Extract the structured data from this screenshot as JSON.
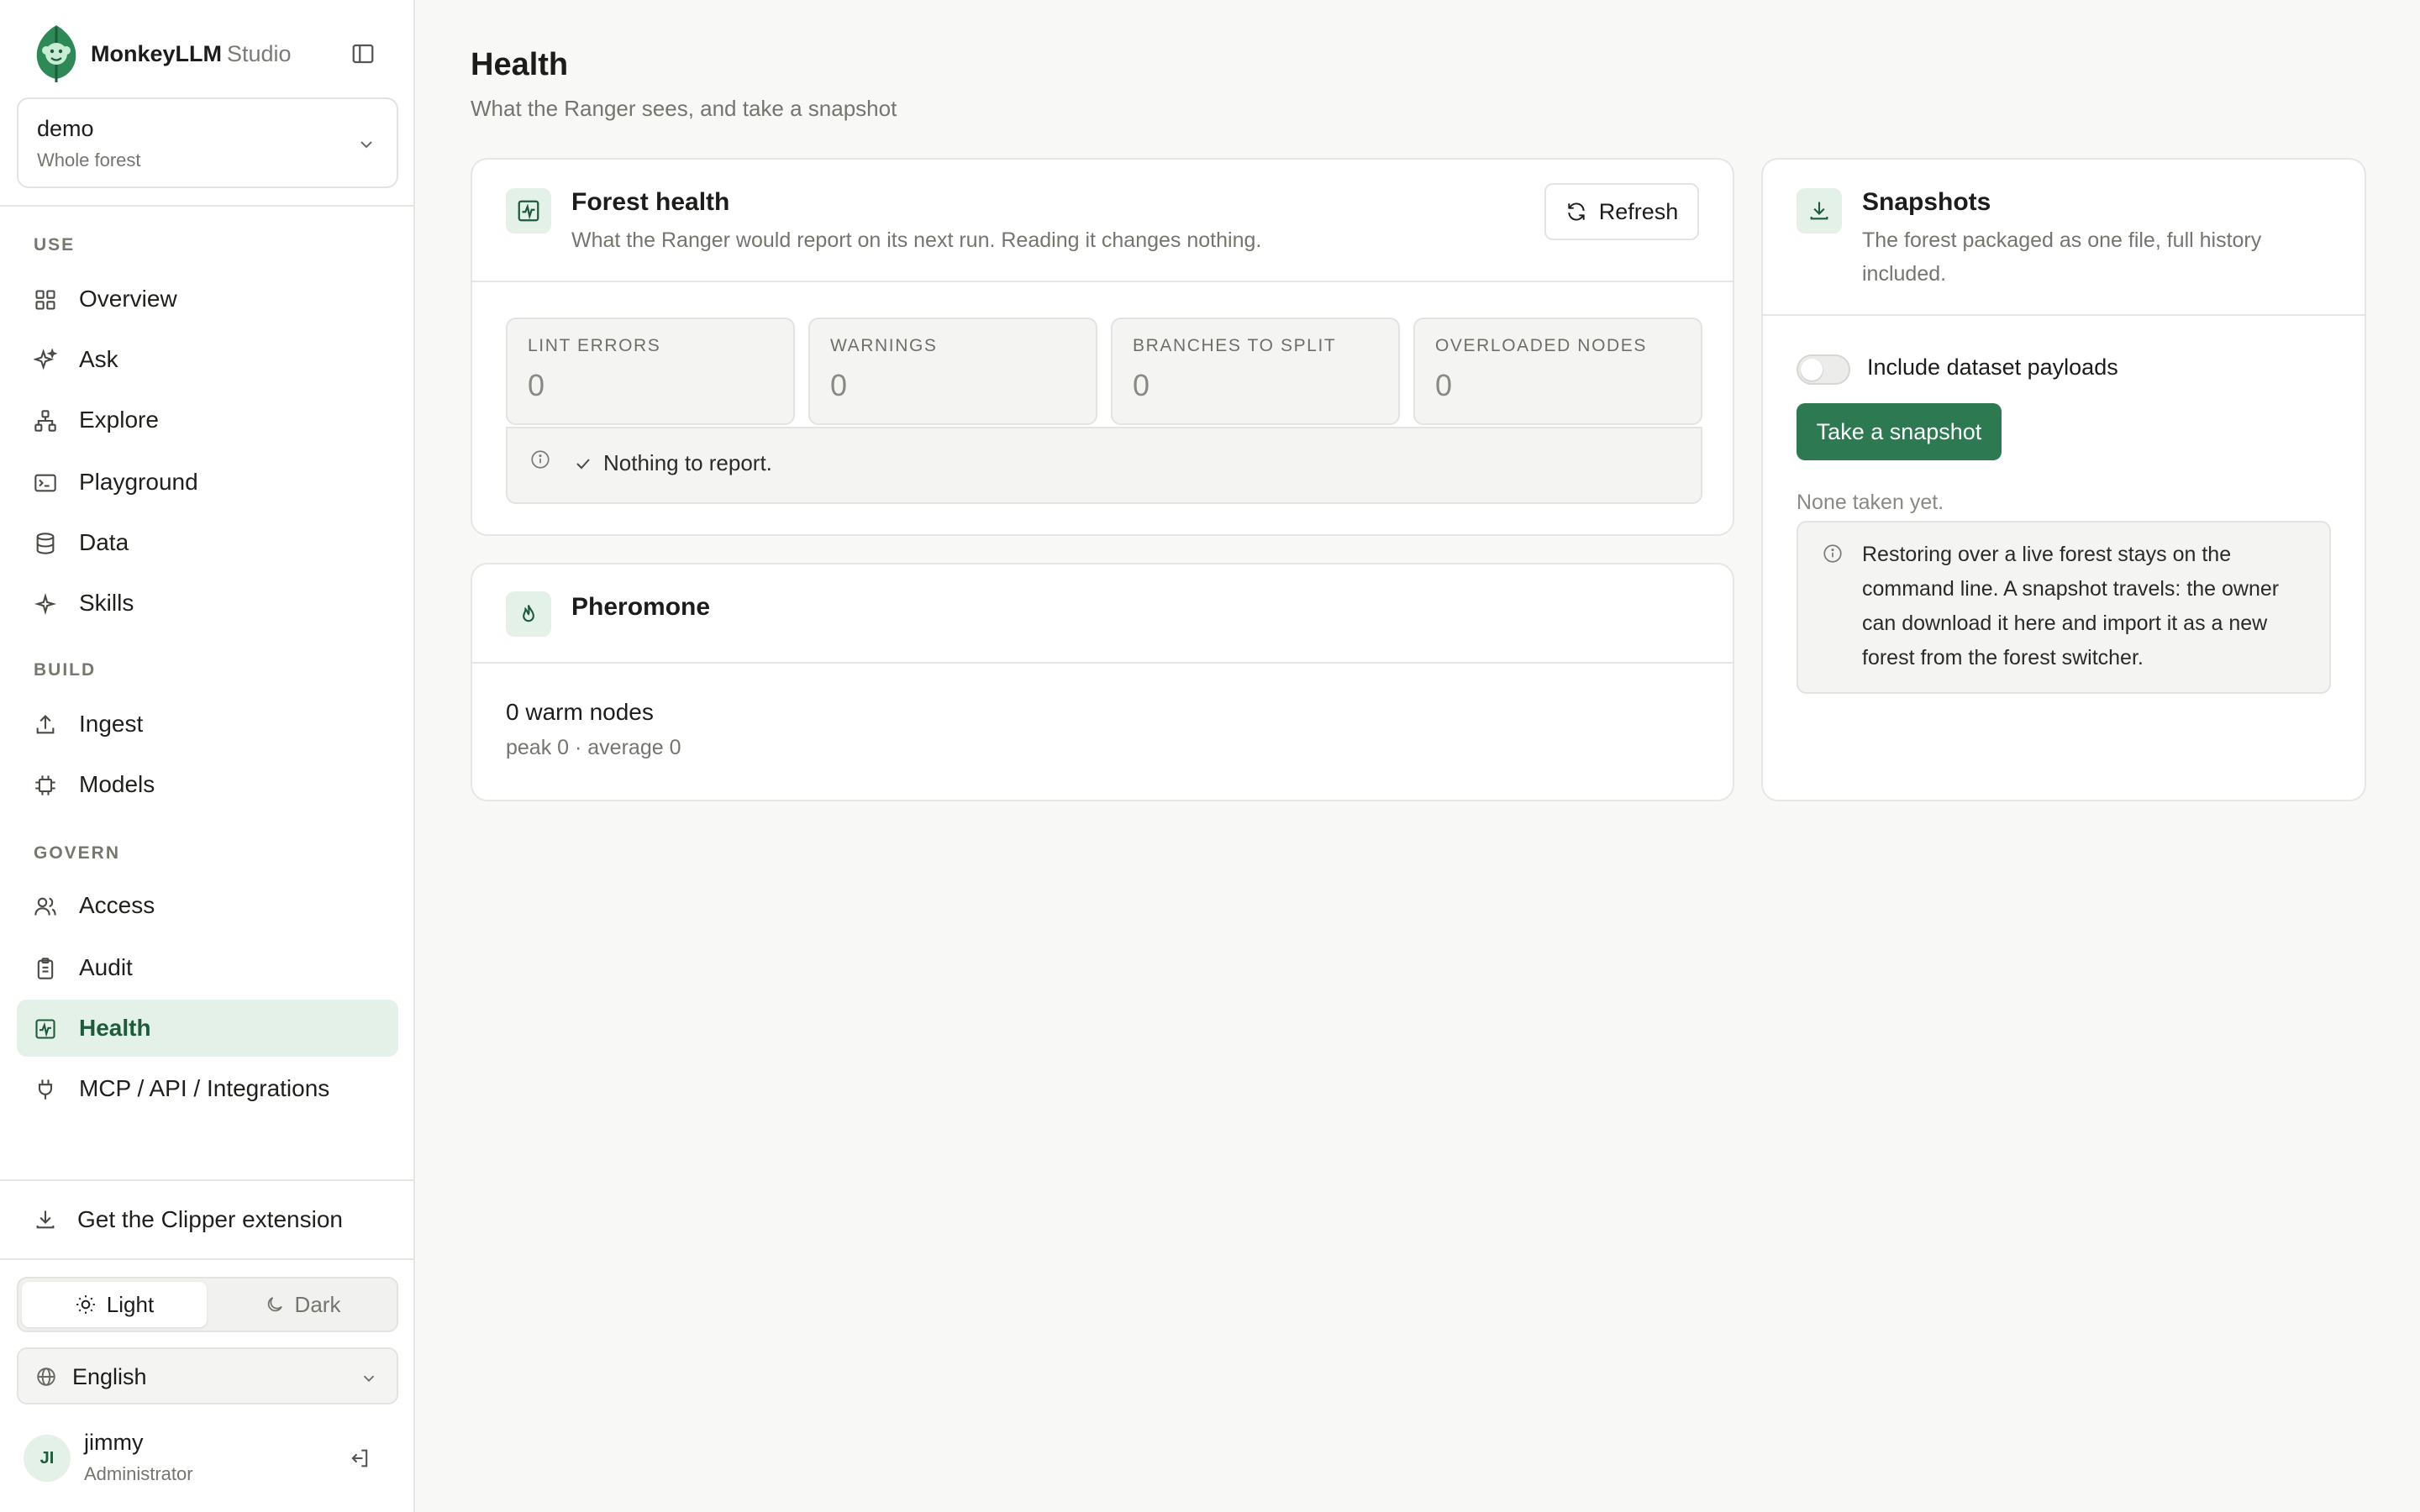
{
  "brand": {
    "name": "MonkeyLLM",
    "suffix": "Studio"
  },
  "forest": {
    "name": "demo",
    "scope": "Whole forest"
  },
  "nav": {
    "use_label": "USE",
    "build_label": "BUILD",
    "govern_label": "GOVERN",
    "use": [
      {
        "label": "Overview",
        "icon": "grid-icon"
      },
      {
        "label": "Ask",
        "icon": "sparkles-icon"
      },
      {
        "label": "Explore",
        "icon": "network-icon"
      },
      {
        "label": "Playground",
        "icon": "terminal-icon"
      },
      {
        "label": "Data",
        "icon": "database-icon"
      },
      {
        "label": "Skills",
        "icon": "sparkle-icon"
      }
    ],
    "build": [
      {
        "label": "Ingest",
        "icon": "upload-icon"
      },
      {
        "label": "Models",
        "icon": "chip-icon"
      }
    ],
    "govern": [
      {
        "label": "Access",
        "icon": "users-icon"
      },
      {
        "label": "Audit",
        "icon": "clipboard-icon"
      },
      {
        "label": "Health",
        "icon": "activity-icon",
        "active": true
      },
      {
        "label": "MCP / API / Integrations",
        "icon": "plug-icon"
      }
    ]
  },
  "clipper": {
    "label": "Get the Clipper extension"
  },
  "theme": {
    "light": "Light",
    "dark": "Dark",
    "selected": "Light"
  },
  "language": {
    "selected": "English"
  },
  "user": {
    "initials": "JI",
    "name": "jimmy",
    "role": "Administrator"
  },
  "page": {
    "title": "Health",
    "subtitle": "What the Ranger sees, and take a snapshot"
  },
  "forest_health": {
    "title": "Forest health",
    "subtitle": "What the Ranger would report on its next run. Reading it changes nothing.",
    "refresh_label": "Refresh",
    "stats": [
      {
        "label": "LINT ERRORS",
        "value": "0"
      },
      {
        "label": "WARNINGS",
        "value": "0"
      },
      {
        "label": "BRANCHES TO SPLIT",
        "value": "0"
      },
      {
        "label": "OVERLOADED NODES",
        "value": "0"
      }
    ],
    "report": "Nothing to report."
  },
  "pheromone": {
    "title": "Pheromone",
    "warm_nodes": "0 warm nodes",
    "summary": "peak 0 · average 0"
  },
  "snapshots": {
    "title": "Snapshots",
    "subtitle": "The forest packaged as one file, full history included.",
    "toggle_label": "Include dataset payloads",
    "toggle_on": false,
    "button_label": "Take a snapshot",
    "status": "None taken yet.",
    "note": "Restoring over a live forest stays on the command line. A snapshot travels: the owner can download it here and import it as a new forest from the forest switcher."
  },
  "colors": {
    "accent": "#2d7a52",
    "accent_soft": "#e3f1e8",
    "accent_text": "#1d5b3b"
  }
}
